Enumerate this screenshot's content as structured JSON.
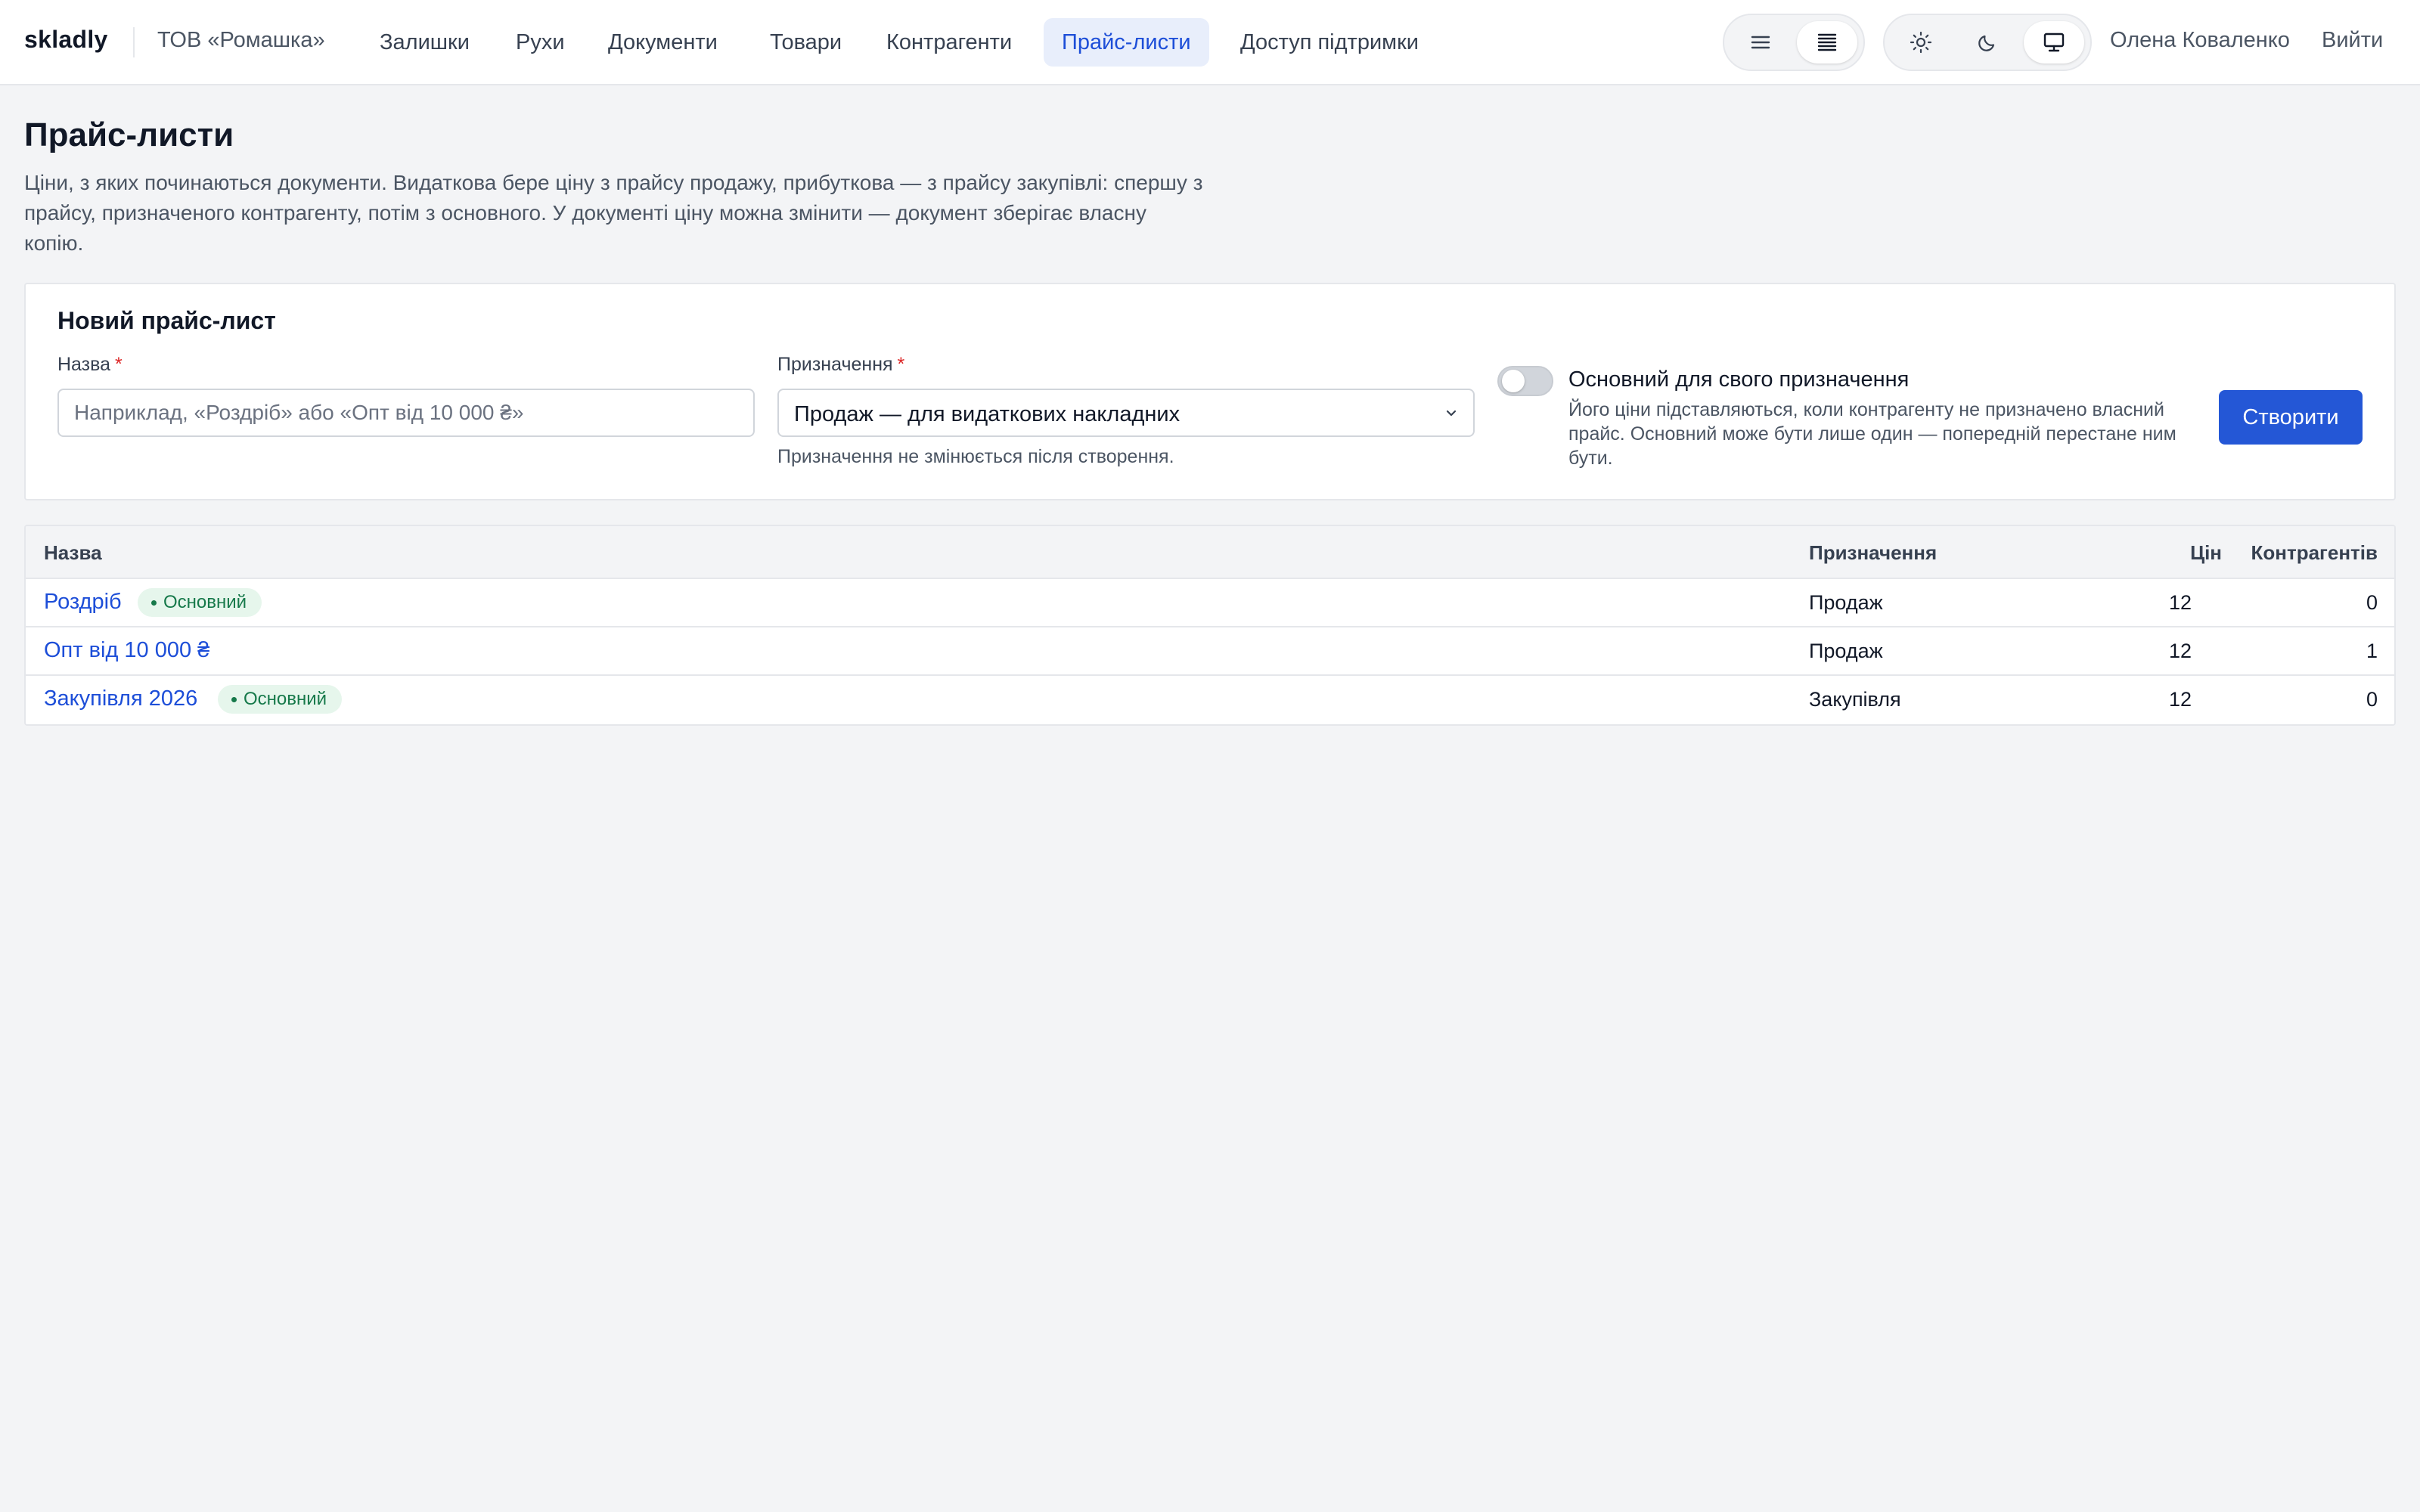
{
  "app": {
    "brand": "skladly",
    "organization": "ТОВ «Ромашка»",
    "user_name": "Олена Коваленко",
    "logout_label": "Вийти"
  },
  "nav": {
    "items": [
      {
        "label": "Залишки",
        "active": false
      },
      {
        "label": "Рухи",
        "active": false
      },
      {
        "label": "Документи",
        "active": false
      },
      {
        "label": "Товари",
        "active": false
      },
      {
        "label": "Контрагенти",
        "active": false
      },
      {
        "label": "Прайс-листи",
        "active": true
      },
      {
        "label": "Доступ підтримки",
        "active": false
      }
    ]
  },
  "toolbar": {
    "density_icons": [
      "list-comfortable-icon",
      "list-compact-icon"
    ],
    "density_selected": "list-compact-icon",
    "theme_icons": [
      "sun-icon",
      "moon-icon",
      "monitor-icon"
    ],
    "theme_selected": "monitor-icon"
  },
  "page": {
    "title": "Прайс-листи",
    "description": "Ціни, з яких починаються документи. Видаткова бере ціну з прайсу продажу, прибуткова — з прайсу закупівлі: спершу з прайсу, призначеного контрагенту, потім з основного. У документі ціну можна змінити — документ зберігає власну копію."
  },
  "form": {
    "title": "Новий прайс-лист",
    "name_label": "Назва",
    "name_value": "",
    "name_placeholder": "Наприклад, «Роздріб» або «Опт від 10 000 ₴»",
    "required_mark": "*",
    "purpose_label": "Призначення",
    "purpose_value": "Продаж — для видаткових накладних",
    "purpose_hint": "Призначення не змінюється після створення.",
    "default_toggle_label": "Основний для свого призначення",
    "default_toggle_on": false,
    "default_toggle_desc": "Його ціни підставляються, коли контрагенту не призначено власний прайс. Основний може бути лише один — попередній перестане ним бути.",
    "create_label": "Створити"
  },
  "table": {
    "headers": {
      "name": "Назва",
      "purpose": "Призначення",
      "prices": "Цін",
      "counterparties": "Контрагентів"
    },
    "badge_label": "Основний",
    "rows": [
      {
        "name": "Роздріб",
        "default": true,
        "purpose": "Продаж",
        "prices": "12",
        "counterparties": "0"
      },
      {
        "name": "Опт від 10 000 ₴",
        "default": false,
        "purpose": "Продаж",
        "prices": "12",
        "counterparties": "1"
      },
      {
        "name": "Закупівля 2026",
        "default": true,
        "purpose": "Закупівля",
        "prices": "12",
        "counterparties": "0"
      }
    ]
  },
  "colors": {
    "accent": "#2457d6",
    "link": "#1d4ed8",
    "badge_bg": "#e6f6ec",
    "badge_text": "#16794a",
    "required": "#dc2626"
  }
}
